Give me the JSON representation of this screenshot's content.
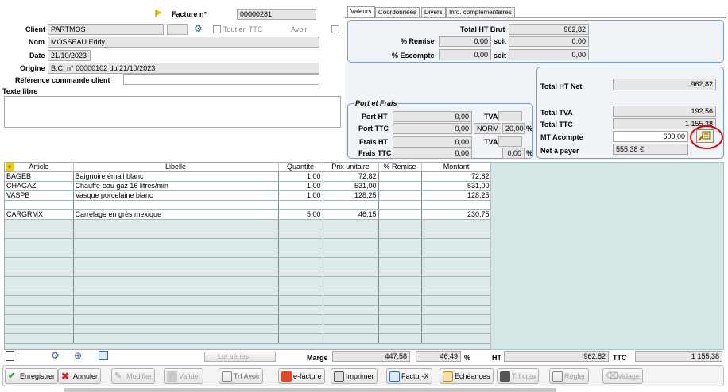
{
  "header": {
    "facture_label": "Facture n°",
    "facture_no": "00000281",
    "client_label": "Client",
    "client": "PARTMOS",
    "tout_ttc": "Tout en TTC",
    "avoir": "Avoir",
    "nom_label": "Nom",
    "nom": "MOSSEAU Eddy",
    "date_label": "Date",
    "date": "21/10/2023",
    "origine_label": "Origine",
    "origine": "B.C. n° 00000102 du 21/10/2023",
    "ref_label": "Référence commande client",
    "ref": "",
    "texte_libre_label": "Texte libre"
  },
  "tabs": [
    "Valeurs",
    "Coordonnées",
    "Divers",
    "Info. complémentaires"
  ],
  "valeurs": {
    "total_ht_brut_label": "Total HT Brut",
    "total_ht_brut": "962,82",
    "remise_label": "% Remise",
    "remise_pct": "0,00",
    "soit": "soit",
    "remise_val": "0,00",
    "escompte_label": "% Escompte",
    "escompte_pct": "0,00",
    "escompte_val": "0,00"
  },
  "port": {
    "title": "Port et Frais",
    "port_ht_label": "Port HT",
    "port_ht": "0,00",
    "tva_label": "TVA",
    "port_ttc_label": "Port TTC",
    "port_ttc": "0,00",
    "norm": "NORM",
    "norm_rate": "20,00",
    "pct": "%",
    "frais_ht_label": "Frais HT",
    "frais_ht": "0,00",
    "frais_ttc_label": "Frais TTC",
    "frais_ttc": "0,00",
    "frais_rate": "0,00"
  },
  "totals": {
    "total_ht_net_label": "Total HT Net",
    "total_ht_net": "962,82",
    "total_tva_label": "Total TVA",
    "total_tva": "192,56",
    "total_ttc_label": "Total TTC",
    "total_ttc": "1 155,38",
    "mt_acompte_label": "MT Acompte",
    "mt_acompte": "600,00",
    "net_label": "Net à payer",
    "net": "555,38 €"
  },
  "grid": {
    "columns": [
      "Article",
      "Libellé",
      "Quantité",
      "Prix unitaire",
      "% Remise",
      "Montant"
    ],
    "rows": [
      [
        "BAGEB",
        "Baignoire émail blanc",
        "1,00",
        "72,82",
        "",
        "72,82"
      ],
      [
        "CHAGAZ",
        "Chauffe-eau gaz 16 litres/min",
        "1,00",
        "531,00",
        "",
        "531,00"
      ],
      [
        "VASPB",
        "Vasque porcelaine blanc",
        "1,00",
        "128,25",
        "",
        "128,25"
      ],
      [
        "",
        "",
        "",
        "",
        "",
        ""
      ],
      [
        "CARGRMX",
        "Carrelage en grès mexique",
        "5,00",
        "46,15",
        "",
        "230,75"
      ]
    ]
  },
  "footer": {
    "lot_series": "Lot séries",
    "marge_label": "Marge",
    "marge": "447,58",
    "marge_pct": "46,49",
    "pct": "%",
    "ht_label": "HT",
    "ht": "962,82",
    "ttc_label": "TTC",
    "ttc": "1 155,38"
  },
  "buttons": {
    "enregistrer": "Enregistrer",
    "annuler": "Annuler",
    "modifier": "Modifier",
    "valider": "Valider",
    "trf_avoir": "Trf Avoir",
    "efacture": "e-facture",
    "imprimer": "Imprimer",
    "facturx": "Factur-X",
    "echeances": "Echéances",
    "trf_cpta": "Trf cpta",
    "regler": "Régler",
    "vidage": "Vidage"
  },
  "colors": {
    "accent_circle": "#e00000",
    "grid_bg": "#dfe9ea",
    "panel_border": "#7a9cc4"
  }
}
